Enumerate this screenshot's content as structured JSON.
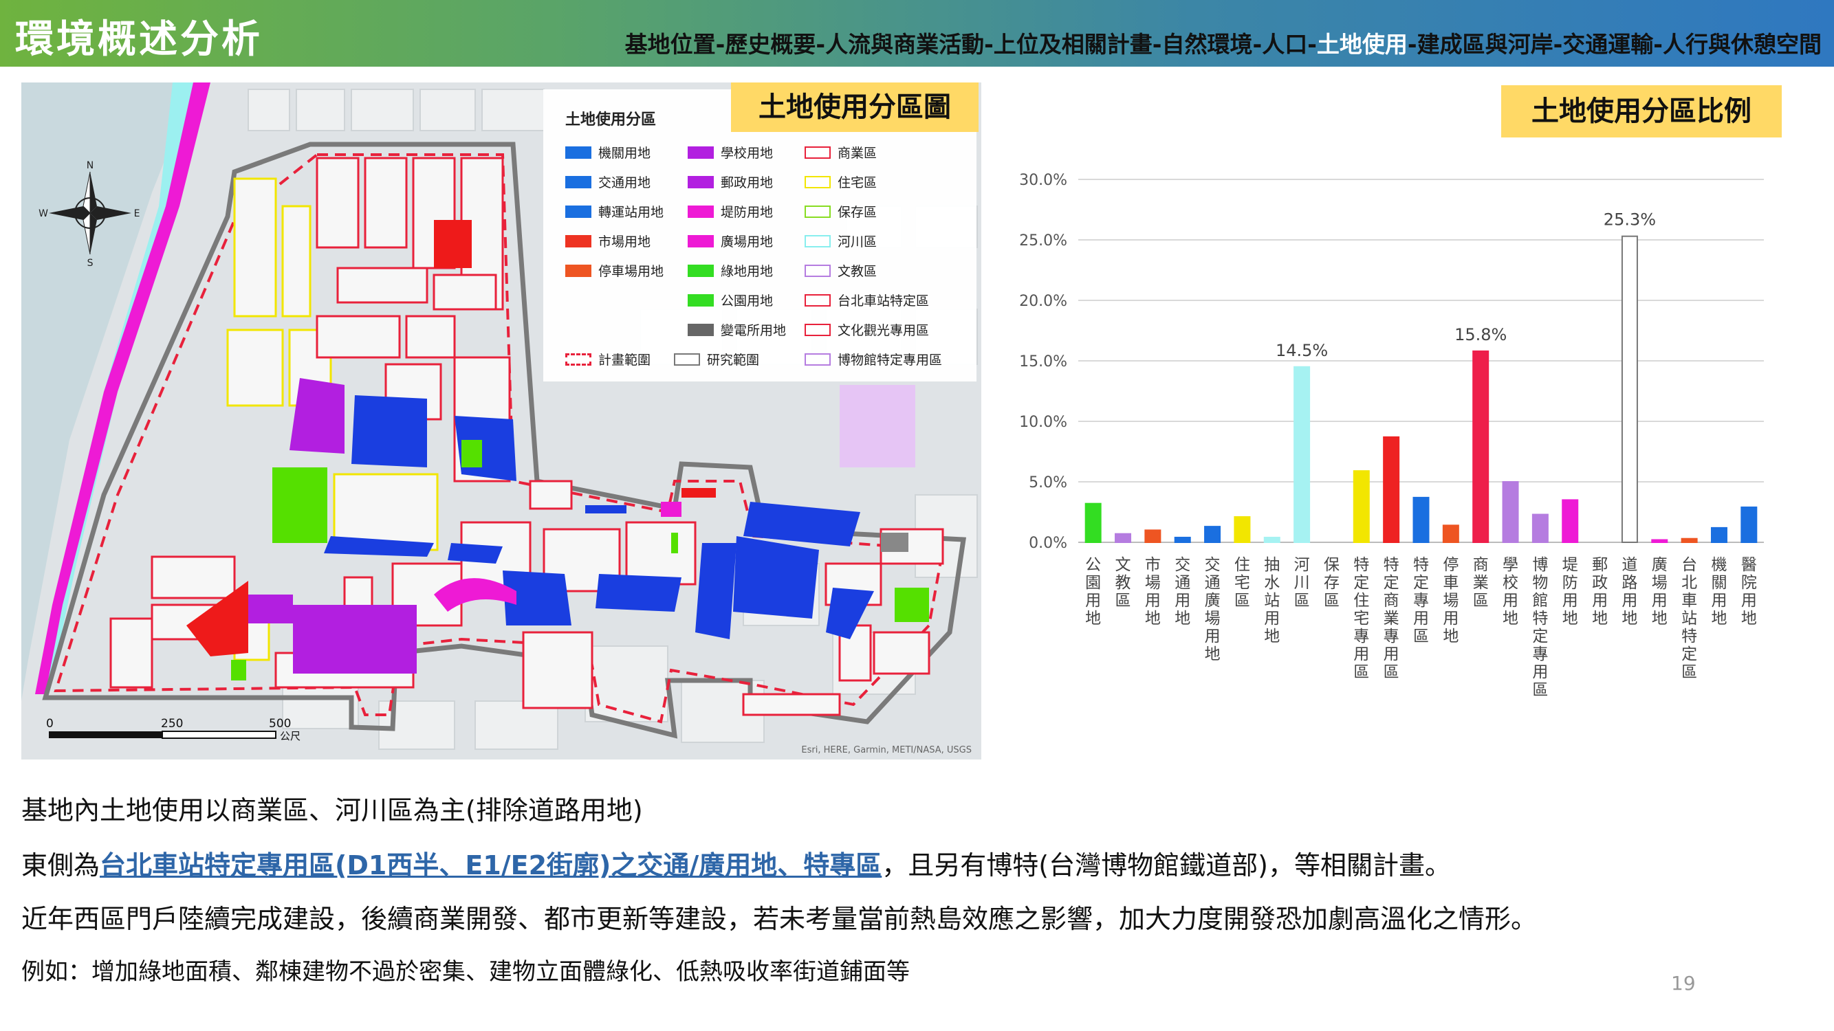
{
  "header": {
    "title": "環境概述分析",
    "breadcrumb": [
      {
        "label": "基地位置",
        "active": false
      },
      {
        "label": "歷史概要",
        "active": false
      },
      {
        "label": "人流與商業活動",
        "active": false
      },
      {
        "label": "上位及相關計畫",
        "active": false
      },
      {
        "label": "自然環境",
        "active": false
      },
      {
        "label": "人口",
        "active": false
      },
      {
        "label": "土地使用",
        "active": true
      },
      {
        "label": "建成區與河岸",
        "active": false
      },
      {
        "label": "交通運輸",
        "active": false
      },
      {
        "label": "人行與休憩空間",
        "active": false
      }
    ],
    "separator": "-"
  },
  "map": {
    "title": "土地使用分區圖",
    "legend_title": "土地使用分區",
    "legend": [
      {
        "label": "機關用地",
        "color": "#1a6fe0",
        "style": "fill"
      },
      {
        "label": "交通用地",
        "color": "#1a6fe0",
        "style": "fill"
      },
      {
        "label": "轉運站用地",
        "color": "#1a6fe0",
        "style": "fill"
      },
      {
        "label": "市場用地",
        "color": "#ee3322",
        "style": "fill"
      },
      {
        "label": "停車場用地",
        "color": "#ee5522",
        "style": "fill"
      },
      {
        "label": "學校用地",
        "color": "#b21fe0",
        "style": "fill"
      },
      {
        "label": "郵政用地",
        "color": "#b21fe0",
        "style": "fill"
      },
      {
        "label": "堤防用地",
        "color": "#ee1ad5",
        "style": "fill"
      },
      {
        "label": "廣場用地",
        "color": "#ee1ad5",
        "style": "fill"
      },
      {
        "label": "綠地用地",
        "color": "#33dd22",
        "style": "fill"
      },
      {
        "label": "公園用地",
        "color": "#33dd22",
        "style": "fill"
      },
      {
        "label": "變電所用地",
        "color": "#666666",
        "style": "fill"
      },
      {
        "label": "商業區",
        "color": "#e8213b",
        "style": "outline"
      },
      {
        "label": "住宅區",
        "color": "#f2e600",
        "style": "outline"
      },
      {
        "label": "保存區",
        "color": "#88dd22",
        "style": "outline"
      },
      {
        "label": "河川區",
        "color": "#88eeee",
        "style": "outline"
      },
      {
        "label": "文教區",
        "color": "#b57ce0",
        "style": "outline"
      },
      {
        "label": "台北車站特定區",
        "color": "#e8213b",
        "style": "outline"
      },
      {
        "label": "文化觀光專用區",
        "color": "#e8213b",
        "style": "outline"
      },
      {
        "label": "博物館特定專用區",
        "color": "#b57ce0",
        "style": "outline"
      },
      {
        "label": "計畫範圍",
        "color": "#e8213b",
        "style": "dashed"
      },
      {
        "label": "研究範圍",
        "color": "#777777",
        "style": "outline"
      }
    ],
    "compass": {
      "n": "N",
      "e": "E",
      "s": "S",
      "w": "W"
    },
    "scale": {
      "ticks": [
        "0",
        "250",
        "500"
      ],
      "unit": "公尺"
    },
    "attribution": "Esri, HERE, Garmin, METI/NASA, USGS"
  },
  "chart_title": "土地使用分區比例",
  "chart_data": {
    "type": "bar",
    "categories": [
      "公園用地",
      "文教區",
      "市場用地",
      "交通用地",
      "交通廣場用地",
      "住宅區",
      "抽水站用地",
      "河川區",
      "保存區",
      "特定住宅專用區",
      "特定商業專用區",
      "特定專用區",
      "停車場用地",
      "商業區",
      "學校用地",
      "博物館特定專用區",
      "堤防用地",
      "郵政用地",
      "道路用地",
      "廣場用地",
      "台北車站特定區",
      "機關用地",
      "醫院用地"
    ],
    "values": [
      3.2,
      0.7,
      1.0,
      0.4,
      1.3,
      2.1,
      0.4,
      14.5,
      0.0,
      5.9,
      8.7,
      3.7,
      1.4,
      15.8,
      5.0,
      2.3,
      3.5,
      0.0,
      25.3,
      0.2,
      0.3,
      1.2,
      2.9
    ],
    "colors": [
      "#33dd22",
      "#b57ce0",
      "#ee5522",
      "#1a6fe0",
      "#1a6fe0",
      "#f2e600",
      "#a6f2f2",
      "#a6f2f2",
      "#88dd22",
      "#f2e600",
      "#ee2222",
      "#1a6fe0",
      "#ee5522",
      "#ee1f4a",
      "#b57ce0",
      "#b57ce0",
      "#ee1ad5",
      "#b21fe0",
      "#ffffff",
      "#ee1ad5",
      "#ee5522",
      "#1a6fe0",
      "#1a6fe0"
    ],
    "data_labels": {
      "7": "14.5%",
      "13": "15.8%",
      "18": "25.3%"
    },
    "yticks": [
      "0.0%",
      "5.0%",
      "10.0%",
      "15.0%",
      "20.0%",
      "25.0%",
      "30.0%"
    ],
    "ylim": [
      0,
      30
    ],
    "grid": true
  },
  "body": {
    "line1": "基地內土地使用以商業區、河川區為主(排除道路用地)",
    "line2_pre": "東側為",
    "line2_hl": "台北車站特定專用區(D1西半、E1/E2街廓)之交通/廣用地、特專區",
    "line2_post": "，且另有博特(台灣博物館鐵道部)，等相關計畫。",
    "line3": "近年西區門戶陸續完成建設，後續商業開發、都市更新等建設，若未考量當前熱島效應之影響，加大力度開發恐加劇高溫化之情形。",
    "line4": "例如：增加綠地面積、鄰棟建物不過於密集、建物立面體綠化、低熱吸收率街道鋪面等"
  },
  "page_number": "19"
}
